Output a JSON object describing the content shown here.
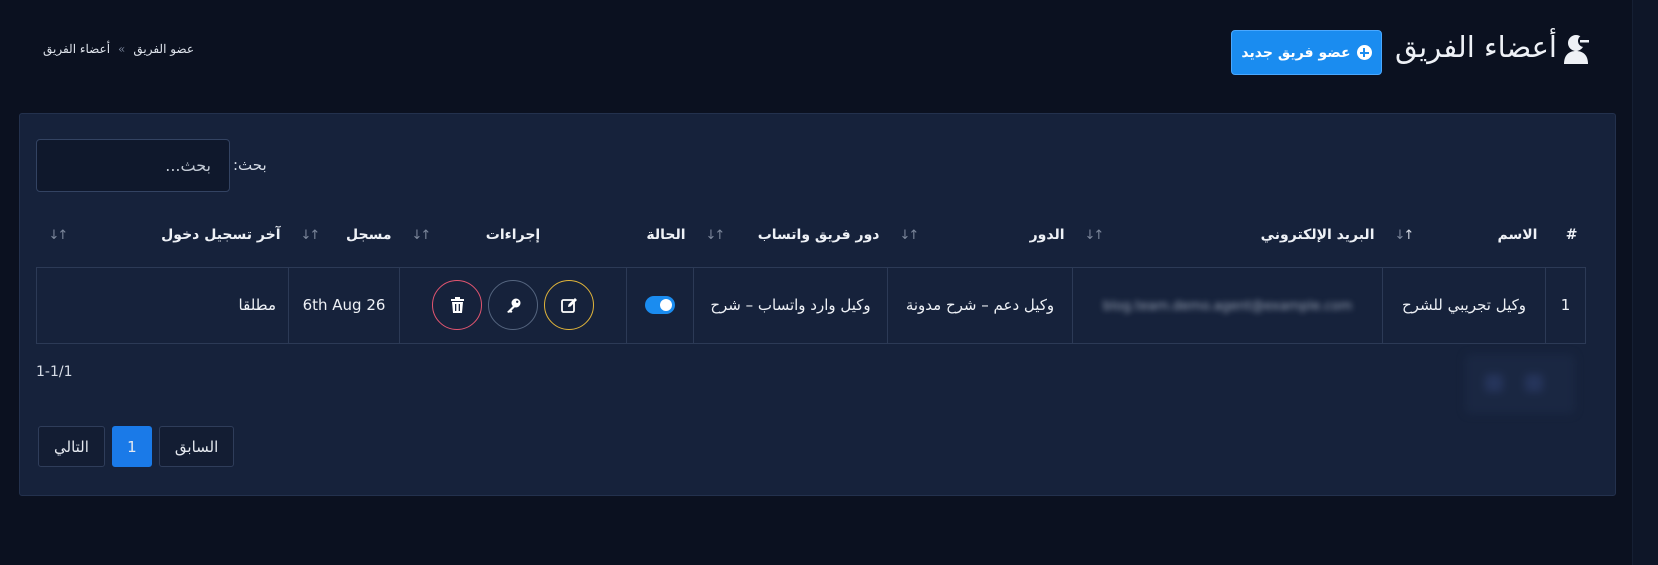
{
  "header": {
    "title": "أعضاء الفريق",
    "title_icon": "user-minus-icon",
    "new_button_label": "عضو فريق جديد",
    "new_button_icon": "plus-circle-icon",
    "breadcrumb": {
      "current": "أعضاء الفريق",
      "separator": "»",
      "link": "عضو الفريق"
    }
  },
  "search": {
    "label": "بحث:",
    "placeholder": "بحث..."
  },
  "table": {
    "columns": [
      "#",
      "الاسم",
      "البريد الإلكتروني",
      "الدور",
      "دور فريق واتساب",
      "الحالة",
      "إجراءات",
      "مسجل",
      "آخر تسجيل دخول"
    ],
    "rows": [
      {
        "index": "1",
        "name": "وكيل تجريبي للشرح",
        "email": "blog.team.demo.agent@example.com",
        "role": "وكيل دعم – شرح مدونة",
        "whatsapp_role": "وكيل وارد واتساب – شرح",
        "status": "active",
        "registered": "6th Aug 26",
        "last_login": "مطلقا"
      }
    ]
  },
  "footer": {
    "count": "1-1/1",
    "pagination": {
      "prev": "السابق",
      "current_page": "1",
      "next": "التالي"
    }
  },
  "colors": {
    "background": "#0b1120",
    "card": "#16223b",
    "accent": "#1a8cf0",
    "edit": "#e0b43a",
    "delete": "#e25570"
  }
}
